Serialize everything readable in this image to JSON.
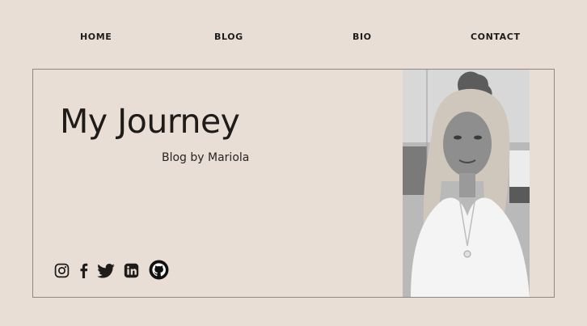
{
  "nav": {
    "home": "HOME",
    "blog": "BLOG",
    "bio": "BIO",
    "contact": "CONTACT"
  },
  "hero": {
    "title": "My Journey",
    "subtitle": "Blog by Mariola"
  },
  "social": {
    "icons": [
      "instagram-icon",
      "facebook-icon",
      "twitter-icon",
      "linkedin-icon",
      "github-icon"
    ]
  },
  "colors": {
    "background": "#e8ded5",
    "text": "#1f1b19",
    "border": "#8f8781"
  }
}
